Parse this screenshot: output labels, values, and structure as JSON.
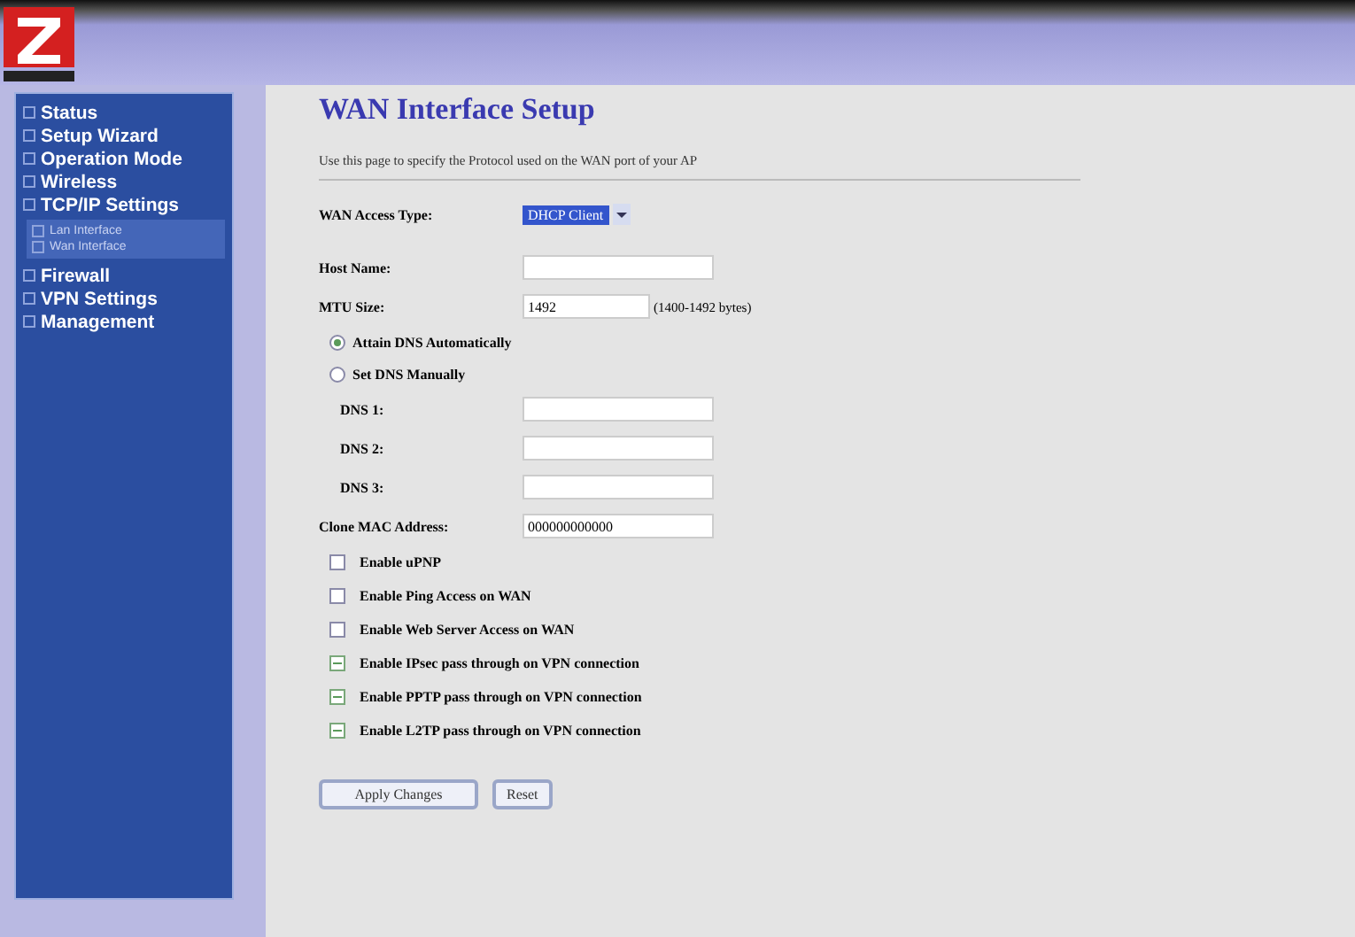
{
  "sidebar": {
    "items": [
      {
        "label": "Status"
      },
      {
        "label": "Setup Wizard"
      },
      {
        "label": "Operation Mode"
      },
      {
        "label": "Wireless"
      },
      {
        "label": "TCP/IP Settings",
        "expanded": true,
        "children": [
          {
            "label": "Lan Interface"
          },
          {
            "label": "Wan Interface"
          }
        ]
      },
      {
        "label": "Firewall"
      },
      {
        "label": "VPN Settings"
      },
      {
        "label": "Management"
      }
    ]
  },
  "page": {
    "title": "WAN Interface Setup",
    "description": "Use this page to specify the Protocol used on the WAN port of your AP"
  },
  "form": {
    "access_type": {
      "label": "WAN Access Type:",
      "value": "DHCP Client"
    },
    "host_name": {
      "label": "Host Name:"
    },
    "mtu": {
      "label": "MTU Size:",
      "value": "1492",
      "hint": "(1400-1492 bytes)"
    },
    "dns_mode": [
      {
        "label": "Attain DNS Automatically",
        "selected": true
      },
      {
        "label": "Set DNS Manually",
        "selected": false
      }
    ],
    "dns": [
      {
        "label": "DNS 1:"
      },
      {
        "label": "DNS 2:"
      },
      {
        "label": "DNS 3:"
      }
    ],
    "clone_mac": {
      "label": "Clone MAC Address:",
      "value": "000000000000"
    },
    "options": [
      {
        "label": "Enable uPNP",
        "checked": false
      },
      {
        "label": "Enable Ping Access on WAN",
        "checked": false
      },
      {
        "label": "Enable Web Server Access on WAN",
        "checked": false
      },
      {
        "label": "Enable IPsec pass through on VPN connection",
        "checked": true
      },
      {
        "label": "Enable PPTP pass through on VPN connection",
        "checked": true
      },
      {
        "label": "Enable L2TP pass through on VPN connection",
        "checked": true
      }
    ],
    "buttons": [
      "Apply Changes",
      "Reset"
    ]
  }
}
